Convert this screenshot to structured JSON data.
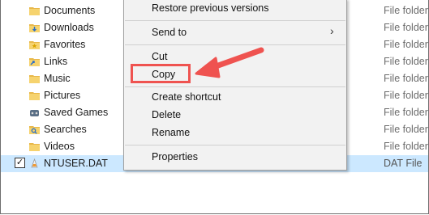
{
  "files": [
    {
      "name": "Documents",
      "type": "File folder",
      "icon": "folder-icon"
    },
    {
      "name": "Downloads",
      "type": "File folder",
      "icon": "downloads-folder-icon"
    },
    {
      "name": "Favorites",
      "type": "File folder",
      "icon": "favorites-folder-icon"
    },
    {
      "name": "Links",
      "type": "File folder",
      "icon": "links-folder-icon"
    },
    {
      "name": "Music",
      "type": "File folder",
      "icon": "folder-icon"
    },
    {
      "name": "Pictures",
      "type": "File folder",
      "icon": "folder-icon"
    },
    {
      "name": "Saved Games",
      "type": "File folder",
      "icon": "saved-games-folder-icon"
    },
    {
      "name": "Searches",
      "type": "File folder",
      "icon": "searches-folder-icon"
    },
    {
      "name": "Videos",
      "type": "File folder",
      "icon": "folder-icon"
    },
    {
      "name": "NTUSER.DAT",
      "type": "DAT File",
      "icon": "dat-file-icon",
      "selected": true,
      "checked": true
    }
  ],
  "context_menu": {
    "items": [
      {
        "label": "Restore previous versions"
      },
      {
        "label": "Send to",
        "submenu": true
      },
      {
        "label": "Cut"
      },
      {
        "label": "Copy",
        "highlighted": true
      },
      {
        "label": "Create shortcut"
      },
      {
        "label": "Delete"
      },
      {
        "label": "Rename"
      },
      {
        "label": "Properties"
      }
    ],
    "submenu_arrow": "›"
  },
  "annotation": {
    "color": "#ef5350",
    "target": "Copy"
  },
  "checkbox_mark": "✓"
}
